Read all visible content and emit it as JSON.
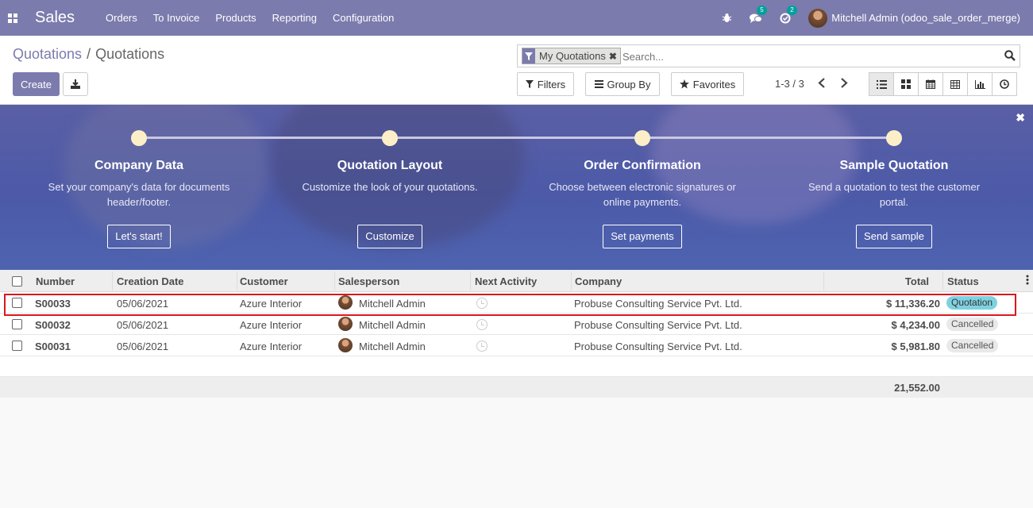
{
  "topbar": {
    "app_name": "Sales",
    "menu": [
      "Orders",
      "To Invoice",
      "Products",
      "Reporting",
      "Configuration"
    ],
    "messages_count": "5",
    "activities_count": "2",
    "user": "Mitchell Admin (odoo_sale_order_merge)",
    "bg_color": "#7c7bad"
  },
  "breadcrumb": {
    "parent": "Quotations",
    "separator": "/",
    "current": "Quotations"
  },
  "actions": {
    "create": "Create"
  },
  "search": {
    "facet": "My Quotations",
    "placeholder": "Search..."
  },
  "filters": {
    "filters": "Filters",
    "group_by": "Group By",
    "favorites": "Favorites"
  },
  "pager": "1-3 / 3",
  "views": [
    "list-icon",
    "kanban-icon",
    "calendar-icon",
    "pivot-icon",
    "graph-icon",
    "activity-icon"
  ],
  "onboarding": {
    "steps": [
      {
        "title": "Company Data",
        "desc": "Set your company's data for documents header/footer.",
        "button": "Let's start!"
      },
      {
        "title": "Quotation Layout",
        "desc": "Customize the look of your quotations.",
        "button": "Customize"
      },
      {
        "title": "Order Confirmation",
        "desc": "Choose between electronic signatures or online payments.",
        "button": "Set payments"
      },
      {
        "title": "Sample Quotation",
        "desc": "Send a quotation to test the customer portal.",
        "button": "Send sample"
      }
    ]
  },
  "table": {
    "columns": [
      "Number",
      "Creation Date",
      "Customer",
      "Salesperson",
      "Next Activity",
      "Company",
      "Total",
      "Status"
    ],
    "rows": [
      {
        "number": "S00033",
        "date": "05/06/2021",
        "customer": "Azure Interior",
        "salesperson": "Mitchell Admin",
        "company": "Probuse Consulting Service Pvt. Ltd.",
        "total": "$ 11,336.20",
        "status": "Quotation"
      },
      {
        "number": "S00032",
        "date": "05/06/2021",
        "customer": "Azure Interior",
        "salesperson": "Mitchell Admin",
        "company": "Probuse Consulting Service Pvt. Ltd.",
        "total": "$ 4,234.00",
        "status": "Cancelled"
      },
      {
        "number": "S00031",
        "date": "05/06/2021",
        "customer": "Azure Interior",
        "salesperson": "Mitchell Admin",
        "company": "Probuse Consulting Service Pvt. Ltd.",
        "total": "$ 5,981.80",
        "status": "Cancelled"
      }
    ],
    "grand_total": "21,552.00"
  },
  "colors": {
    "accent": "#7c7bad",
    "status_quotation": "#7fd1e0",
    "highlight": "#d9181f"
  }
}
